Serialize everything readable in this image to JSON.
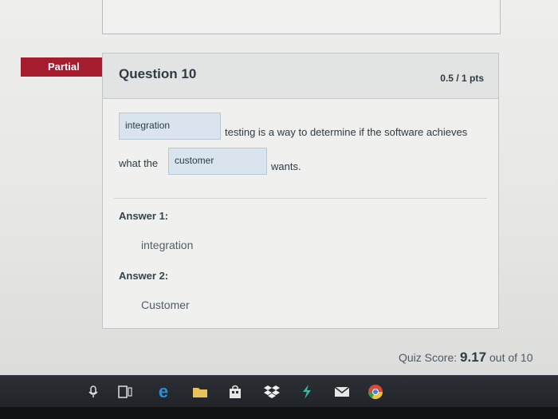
{
  "status_tag": "Partial",
  "question": {
    "title": "Question 10",
    "points": "0.5 / 1 pts",
    "blank1": "integration",
    "text_after_blank1": "testing is a way to determine if the software achieves",
    "text_before_blank2": "what the",
    "blank2": "customer",
    "text_after_blank2": "wants."
  },
  "answers": [
    {
      "label": "Answer 1:",
      "value": "integration"
    },
    {
      "label": "Answer 2:",
      "value": "Customer"
    }
  ],
  "quiz_score": {
    "prefix": "Quiz Score: ",
    "value": "9.17",
    "suffix": " out of 10"
  },
  "taskbar": {
    "icons": [
      "microphone-icon",
      "task-view-icon",
      "edge-icon",
      "file-explorer-icon",
      "store-icon",
      "dropbox-icon",
      "sway-icon",
      "mail-icon",
      "chrome-icon"
    ]
  },
  "colors": {
    "partial_tag": "#a51c2e",
    "blank_fill": "#d9e4ee",
    "taskbar": "#1f2226"
  }
}
